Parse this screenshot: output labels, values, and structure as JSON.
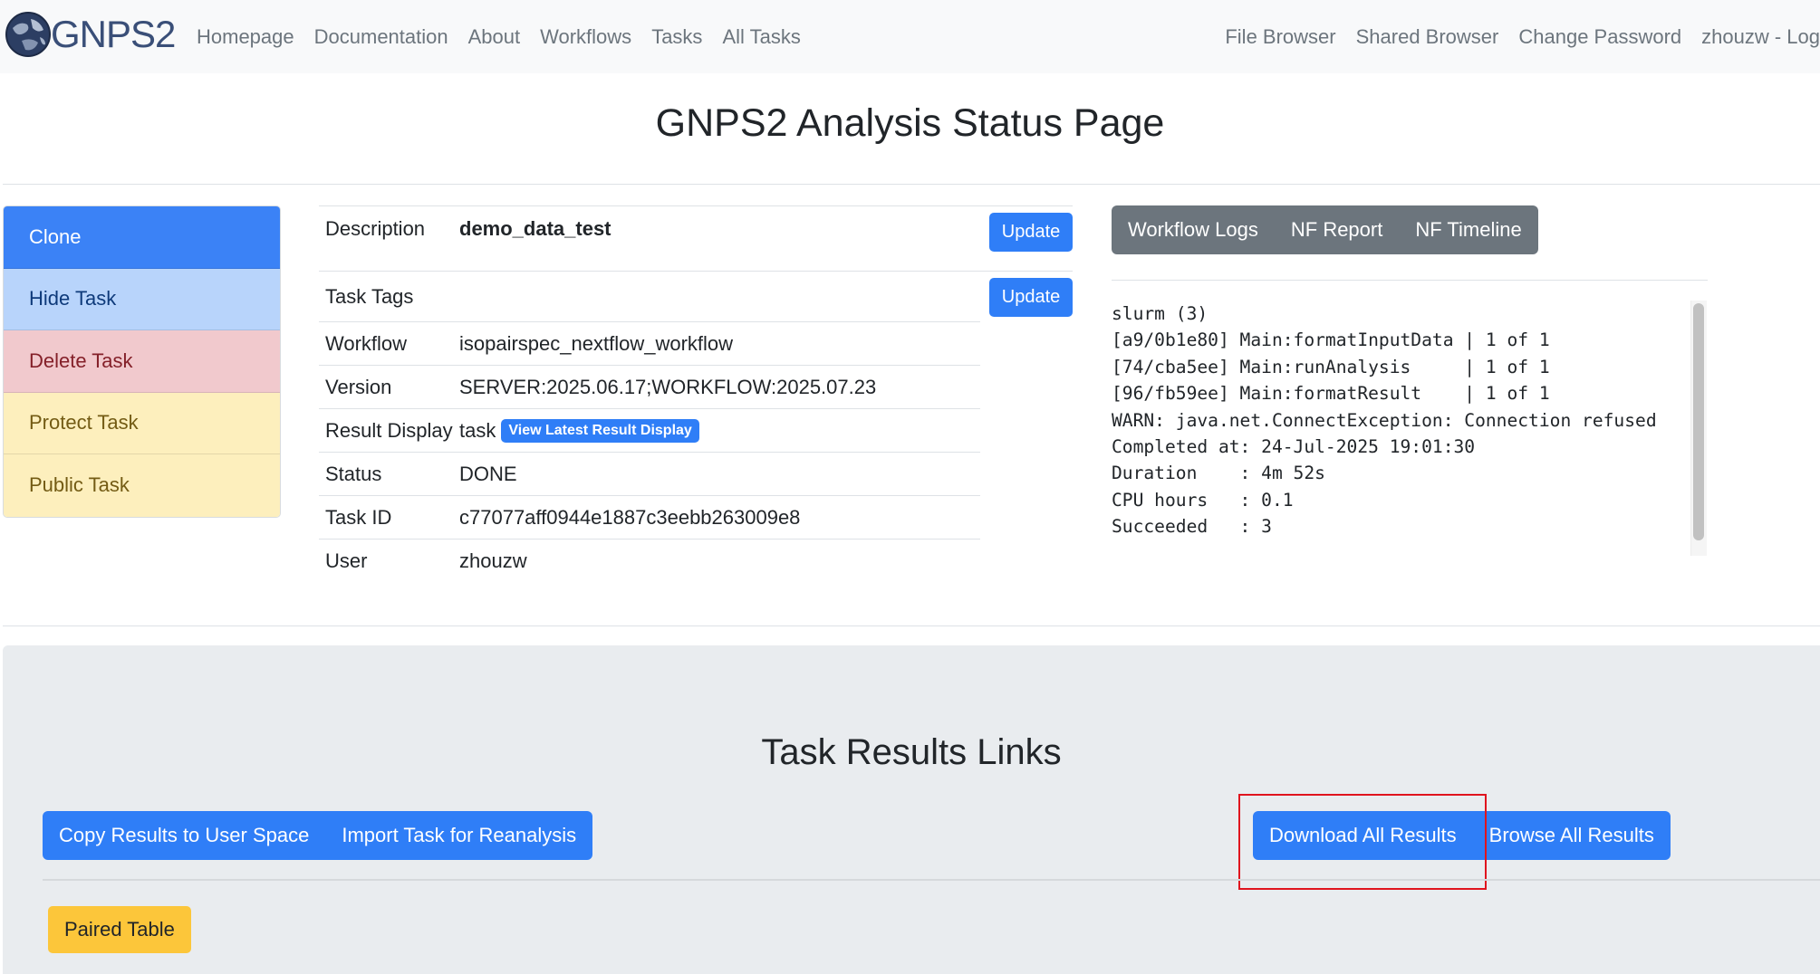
{
  "brand": {
    "text": "GNPS2"
  },
  "nav": {
    "left": [
      "Homepage",
      "Documentation",
      "About",
      "Workflows",
      "Tasks",
      "All Tasks"
    ],
    "right": [
      "File Browser",
      "Shared Browser",
      "Change Password",
      "zhouzw - Log"
    ]
  },
  "page_title": "GNPS2 Analysis Status Page",
  "actions": {
    "clone": "Clone",
    "hide": "Hide Task",
    "delete": "Delete Task",
    "protect": "Protect Task",
    "public": "Public Task"
  },
  "info": {
    "description": {
      "label": "Description",
      "value": "demo_data_test",
      "button": "Update"
    },
    "tags": {
      "label": "Task Tags",
      "value": "",
      "button": "Update"
    },
    "workflow": {
      "label": "Workflow",
      "value": "isopairspec_nextflow_workflow"
    },
    "version": {
      "label": "Version",
      "value": "SERVER:2025.06.17;WORKFLOW:2025.07.23"
    },
    "result_display": {
      "label": "Result Display",
      "value": "task",
      "link": "View Latest Result Display"
    },
    "status": {
      "label": "Status",
      "value": "DONE"
    },
    "task_id": {
      "label": "Task ID",
      "value": "c77077aff0944e1887c3eebb263009e8"
    },
    "user": {
      "label": "User",
      "value": "zhouzw"
    }
  },
  "log_tabs": [
    "Workflow Logs",
    "NF Report",
    "NF Timeline"
  ],
  "log_text": "slurm (3)\n[a9/0b1e80] Main:formatInputData | 1 of 1\n[74/cba5ee] Main:runAnalysis     | 1 of 1\n[96/fb59ee] Main:formatResult    | 1 of 1\nWARN: java.net.ConnectException: Connection refused\nCompleted at: 24-Jul-2025 19:01:30\nDuration    : 4m 52s\nCPU hours   : 0.1\nSucceeded   : 3",
  "results": {
    "title": "Task Results Links",
    "copy": "Copy Results to User Space",
    "import": "Import Task for Reanalysis",
    "download": "Download All Results",
    "browse": "Browse All Results",
    "paired": "Paired Table"
  },
  "colors": {
    "primary": "#2f7ef7",
    "highlight": "#e0141e",
    "warning": "#fcc63a",
    "secondary": "#6c757d"
  }
}
